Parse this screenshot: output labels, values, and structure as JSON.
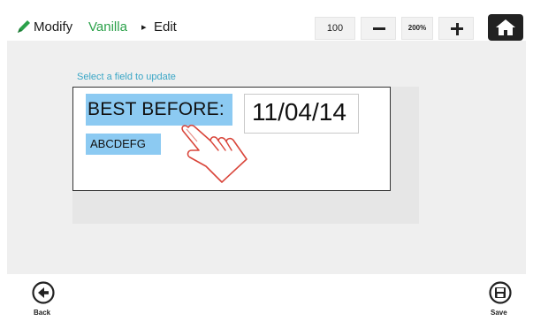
{
  "header": {
    "crumb_modify": "Modify",
    "crumb_vanilla": "Vanilla",
    "crumb_arrow": "▸",
    "crumb_edit": "Edit",
    "zoom_value": "100",
    "zoom_max_label": "200%"
  },
  "editor": {
    "instruction": "Select a field to update",
    "field_label": "BEST BEFORE:",
    "field_value": "11/04/14",
    "code_text": "ABCDEFG"
  },
  "footer": {
    "back_label": "Back",
    "save_label": "Save"
  },
  "colors": {
    "accent_green": "#2ba14a",
    "instruction_blue": "#3aa6c6",
    "selection_blue": "#8ccaf2",
    "hand_red": "#d9453a"
  },
  "icons": [
    "pencil-icon",
    "minus-icon",
    "plus-icon",
    "home-icon",
    "hand-pointer-icon",
    "back-arrow-icon",
    "save-disk-icon"
  ]
}
